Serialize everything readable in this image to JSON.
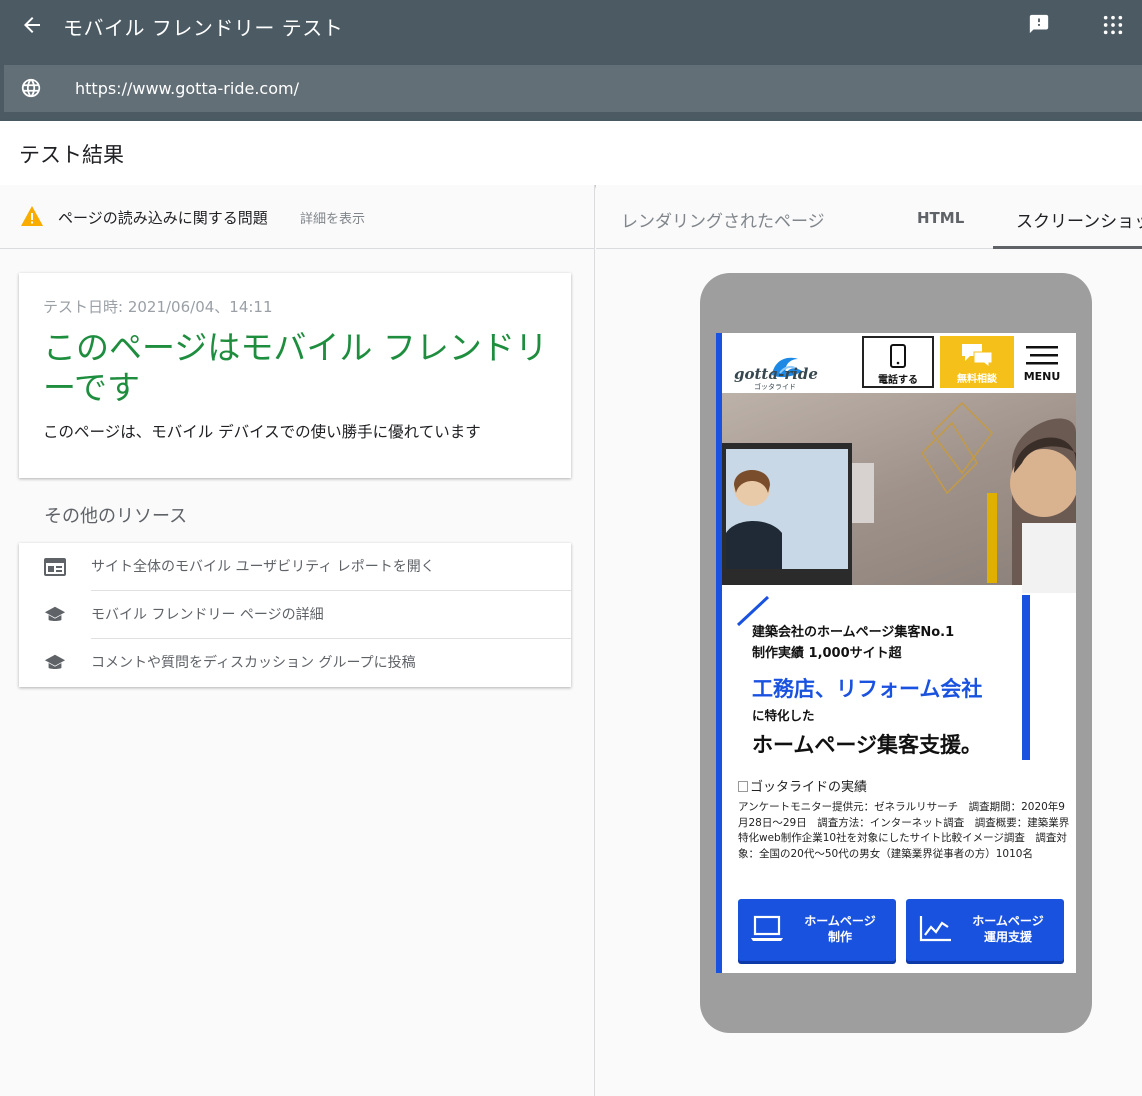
{
  "appbar": {
    "title": "モバイル フレンドリー テスト",
    "back_icon": "arrow-back-icon",
    "feedback_icon": "feedback-icon",
    "apps_icon": "apps-grid-icon"
  },
  "urlbar": {
    "globe_icon": "globe-icon",
    "url": "https://www.gotta-ride.com/"
  },
  "result_header": "テスト結果",
  "warning": {
    "icon": "warning-icon",
    "text": "ページの読み込みに関する問題",
    "link": "詳細を表示",
    "color": "#f9ab00"
  },
  "result_card": {
    "date": "テスト日時: 2021/06/04、14:11",
    "verdict": "このページはモバイル フレンドリーです",
    "description": "このページは、モバイル デバイスでの使い勝手に優れています",
    "verdict_color": "#1e8e3e"
  },
  "other_resources": {
    "heading": "その他のリソース",
    "items": [
      {
        "icon": "web-report-icon",
        "label": "サイト全体のモバイル ユーザビリティ レポートを開く"
      },
      {
        "icon": "school-icon",
        "label": "モバイル フレンドリー ページの詳細"
      },
      {
        "icon": "school-icon",
        "label": "コメントや質問をディスカッション グループに投稿"
      }
    ]
  },
  "tabs": [
    {
      "label": "レンダリングされたページ",
      "active": false
    },
    {
      "label": "HTML",
      "active": false
    },
    {
      "label": "スクリーンショット",
      "active": true
    }
  ],
  "screenshot": {
    "logo_text": "gotta-ride",
    "logo_sub": "ゴッタライド",
    "tel_label": "電話する",
    "consult_label": "無料相談",
    "menu_label": "MENU",
    "copy_line1": "建築会社のホームページ集客No.1",
    "copy_line2": "制作実績 1,000サイト超",
    "copy_line3": "工務店、リフォーム会社",
    "copy_line4": "に特化した",
    "copy_line5": "ホームページ集客支援。",
    "img_alt": "ゴッタライドの実績",
    "note": "アンケートモニター提供元：ゼネラルリサーチ　調査期間：2020年9月28日〜29日　調査方法：インターネット調査　調査概要：建築業界特化web制作企業10社を対象にしたサイト比較イメージ調査　調査対象：全国の20代〜50代の男女（建築業界従事者の方）1010名",
    "buttons": [
      {
        "icon": "laptop-icon",
        "line1": "ホームページ",
        "line2": "制作"
      },
      {
        "icon": "chart-line-icon",
        "line1": "ホームページ",
        "line2": "運用支援"
      }
    ],
    "accent_blue": "#1a52e0",
    "accent_yellow": "#f6c01a"
  }
}
